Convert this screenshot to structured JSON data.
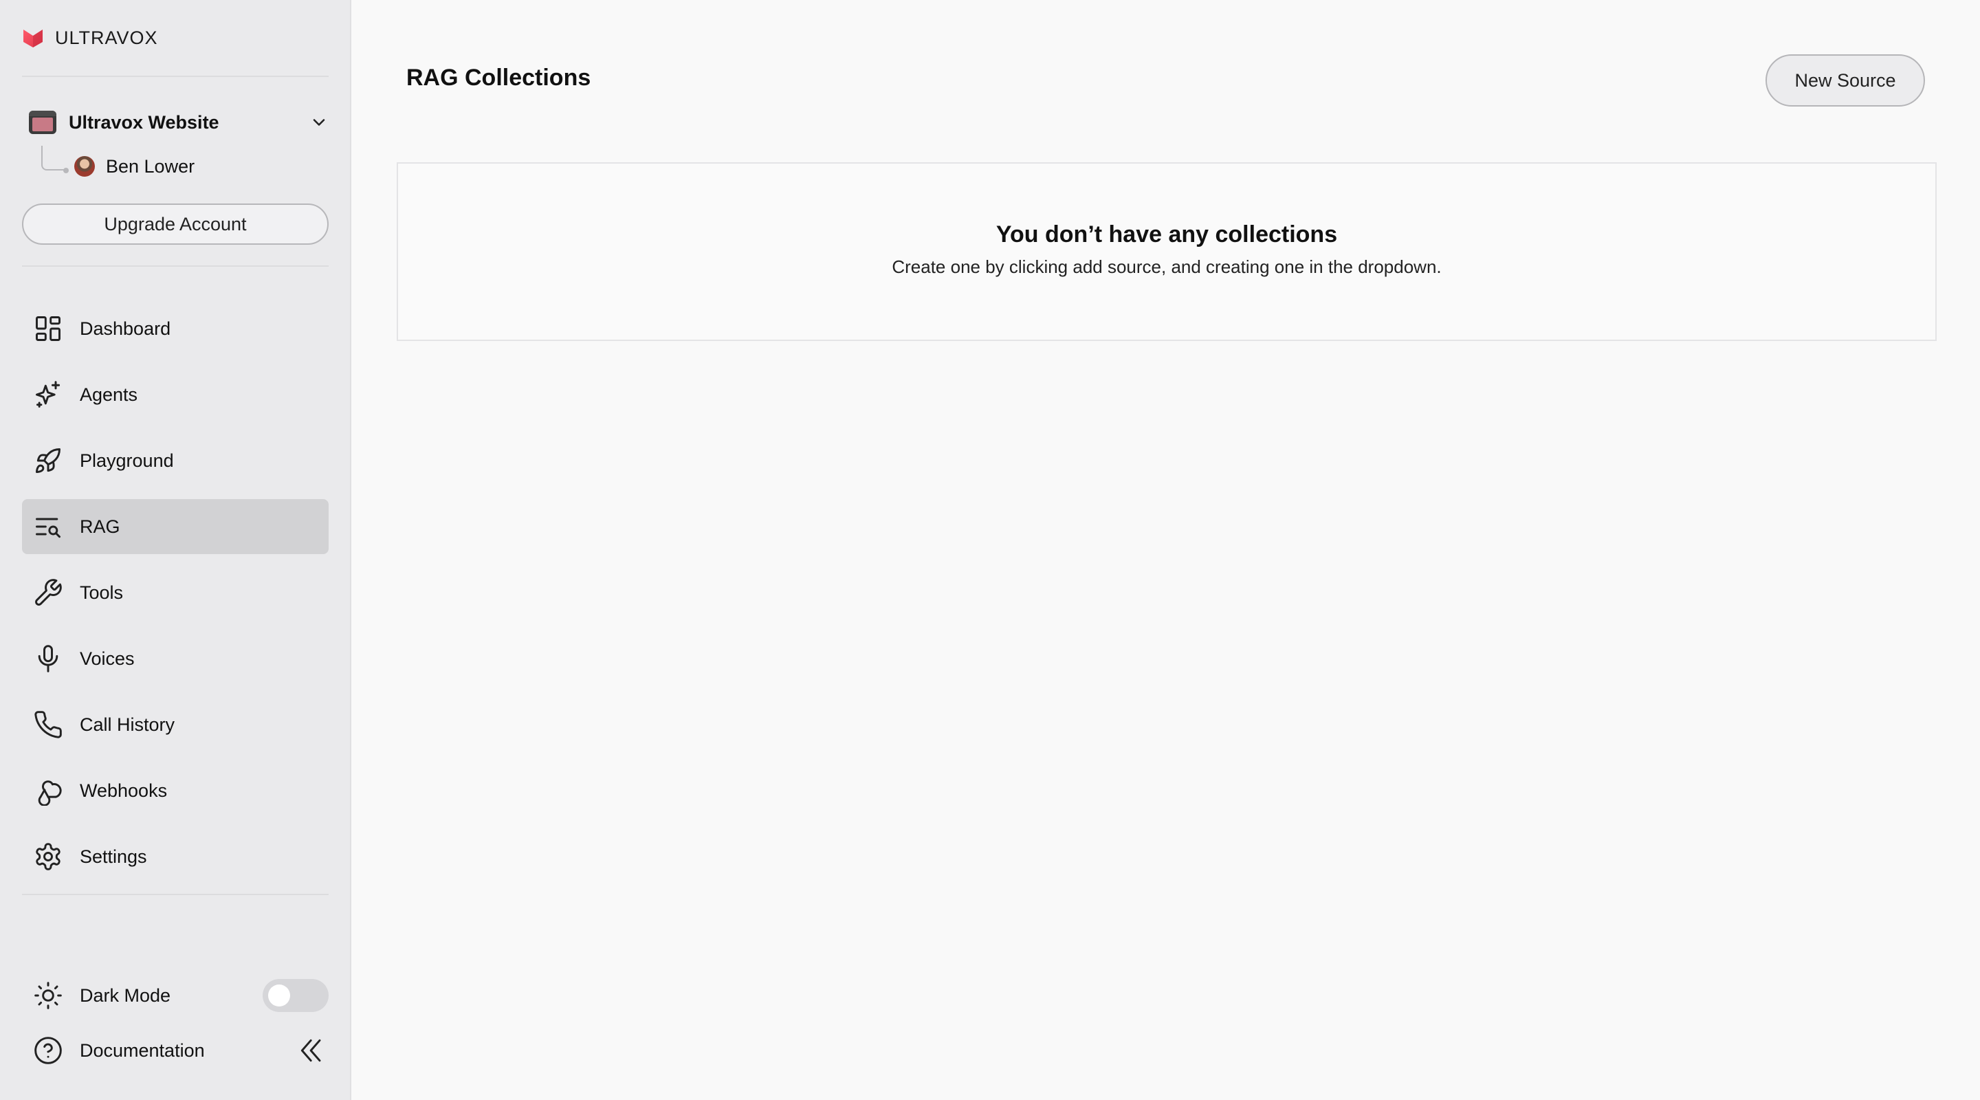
{
  "brand": {
    "name": "ULTRAVOX"
  },
  "org": {
    "name": "Ultravox Website"
  },
  "user": {
    "name": "Ben Lower"
  },
  "upgrade_label": "Upgrade Account",
  "nav": [
    {
      "label": "Dashboard",
      "icon": "dashboard-icon"
    },
    {
      "label": "Agents",
      "icon": "sparkles-icon"
    },
    {
      "label": "Playground",
      "icon": "rocket-icon"
    },
    {
      "label": "RAG",
      "icon": "rag-search-icon",
      "active": true
    },
    {
      "label": "Tools",
      "icon": "wrench-icon"
    },
    {
      "label": "Voices",
      "icon": "microphone-icon"
    },
    {
      "label": "Call History",
      "icon": "phone-icon"
    },
    {
      "label": "Webhooks",
      "icon": "webhook-icon"
    },
    {
      "label": "Settings",
      "icon": "gear-icon"
    }
  ],
  "bottom": {
    "dark_mode_label": "Dark Mode",
    "dark_mode_on": false,
    "documentation_label": "Documentation"
  },
  "main": {
    "title": "RAG Collections",
    "new_source_label": "New Source",
    "empty_title": "You don’t have any collections",
    "empty_subtitle": "Create one by clicking add source, and creating one in the dropdown."
  },
  "colors": {
    "sidebar_bg": "#eaeaec",
    "active_item_bg": "#d2d2d4",
    "main_bg": "#f9f9f9",
    "brand_accent": "#e5484d"
  }
}
